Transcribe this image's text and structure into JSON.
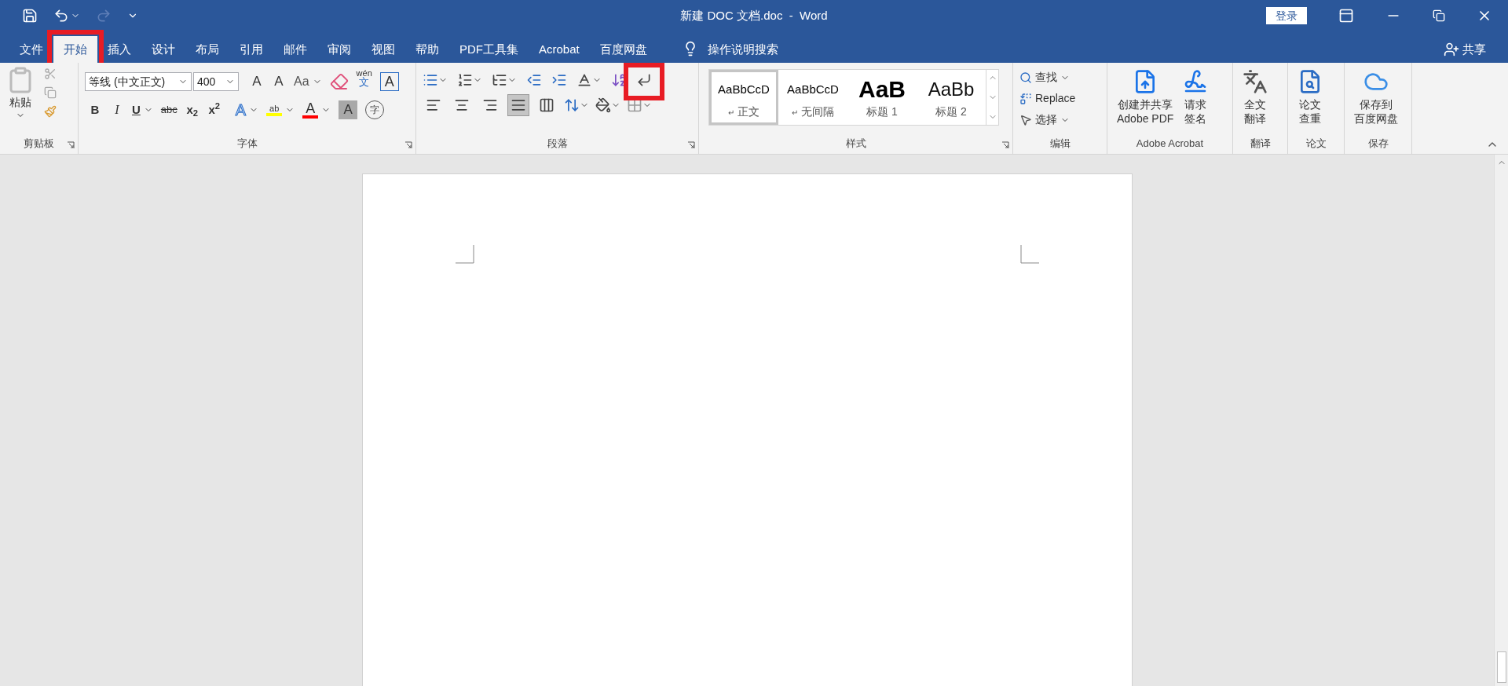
{
  "window": {
    "title": "新建 DOC 文档.doc  -  Word",
    "login": "登录"
  },
  "quick_access": [
    {
      "kind": "save",
      "disabled": false
    },
    {
      "kind": "undo",
      "disabled": false
    },
    {
      "kind": "redo",
      "disabled": true
    },
    {
      "kind": "customize",
      "disabled": false
    }
  ],
  "tabs": [
    {
      "label": "文件",
      "selected": false,
      "highlighted": false
    },
    {
      "label": "开始",
      "selected": true,
      "highlighted": true
    },
    {
      "label": "插入",
      "selected": false,
      "highlighted": false
    },
    {
      "label": "设计",
      "selected": false,
      "highlighted": false
    },
    {
      "label": "布局",
      "selected": false,
      "highlighted": false
    },
    {
      "label": "引用",
      "selected": false,
      "highlighted": false
    },
    {
      "label": "邮件",
      "selected": false,
      "highlighted": false
    },
    {
      "label": "审阅",
      "selected": false,
      "highlighted": false
    },
    {
      "label": "视图",
      "selected": false,
      "highlighted": false
    },
    {
      "label": "帮助",
      "selected": false,
      "highlighted": false
    },
    {
      "label": "PDF工具集",
      "selected": false,
      "highlighted": false
    },
    {
      "label": "Acrobat",
      "selected": false,
      "highlighted": false
    },
    {
      "label": "百度网盘",
      "selected": false,
      "highlighted": false
    }
  ],
  "tell_me": "操作说明搜索",
  "share": "共享",
  "clipboard": {
    "paste": "粘贴",
    "group": "剪贴板"
  },
  "font": {
    "group": "字体",
    "name": "等线 (中文正文)",
    "size": "400",
    "row1": [
      {
        "kind": "grow",
        "label": "A"
      },
      {
        "kind": "shrink",
        "label": "A"
      },
      {
        "kind": "case",
        "label": "Aa"
      },
      {
        "kind": "clear"
      },
      {
        "kind": "phonetic",
        "label": "wén",
        "sub": "文"
      },
      {
        "kind": "border",
        "label": "A"
      }
    ],
    "row2": [
      {
        "kind": "bold",
        "label": "B"
      },
      {
        "kind": "italic",
        "label": "I"
      },
      {
        "kind": "underline",
        "label": "U"
      },
      {
        "kind": "strike",
        "label": "abc"
      },
      {
        "kind": "script",
        "label": "x$_{2}$"
      },
      {
        "kind": "script",
        "label": "x$^{2}$"
      },
      {
        "kind": "effects",
        "label": "A"
      },
      {
        "kind": "highlight",
        "label": "ab",
        "color": "#ffff00"
      },
      {
        "kind": "color",
        "label": "A",
        "color": "#ff0000"
      },
      {
        "kind": "shade",
        "label": "A"
      },
      {
        "kind": "enclose",
        "label": "字"
      }
    ]
  },
  "paragraph": {
    "group": "段落",
    "show_marks_highlighted": true,
    "align": [
      {
        "kind": "left",
        "selected": false
      },
      {
        "kind": "center",
        "selected": false
      },
      {
        "kind": "right",
        "selected": false
      },
      {
        "kind": "justify",
        "selected": true
      },
      {
        "kind": "distributed",
        "selected": false
      }
    ]
  },
  "styles": {
    "group": "样式",
    "items": [
      {
        "preview": "AaBbCcD",
        "name": "正文",
        "mark": "↵",
        "kind": "body",
        "selected": true
      },
      {
        "preview": "AaBbCcD",
        "name": "无间隔",
        "mark": "↵",
        "kind": "body",
        "selected": false
      },
      {
        "preview": "AaB",
        "name": "标题 1",
        "kind": "heading1",
        "selected": false
      },
      {
        "preview": "AaBb",
        "name": "标题 2",
        "kind": "heading2",
        "selected": false
      }
    ]
  },
  "editing": {
    "group": "编辑",
    "find": "查找",
    "replace": "Replace",
    "select": "选择"
  },
  "acrobat": {
    "group": "Adobe Acrobat",
    "create": [
      "创建并共享",
      "Adobe PDF"
    ],
    "sign": [
      "请求",
      "签名"
    ]
  },
  "translate": {
    "group": "翻译",
    "button": [
      "全文",
      "翻译"
    ]
  },
  "thesis": {
    "group": "论文",
    "button": [
      "论文",
      "查重"
    ]
  },
  "save": {
    "group": "保存",
    "button": [
      "保存到",
      "百度网盘"
    ]
  }
}
